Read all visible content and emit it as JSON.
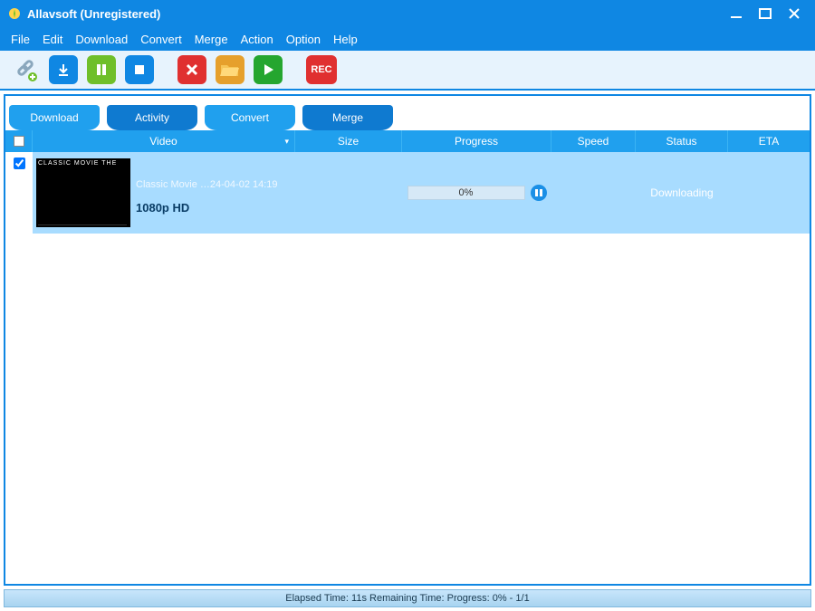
{
  "window": {
    "title": "Allavsoft (Unregistered)"
  },
  "menu": {
    "file": "File",
    "edit": "Edit",
    "download": "Download",
    "convert": "Convert",
    "merge": "Merge",
    "action": "Action",
    "option": "Option",
    "help": "Help"
  },
  "toolbar": {
    "rec_label": "REC"
  },
  "tabs": {
    "download": "Download",
    "activity": "Activity",
    "convert": "Convert",
    "merge": "Merge"
  },
  "columns": {
    "video": "Video",
    "size": "Size",
    "progress": "Progress",
    "speed": "Speed",
    "status": "Status",
    "eta": "ETA"
  },
  "rows": [
    {
      "checked": true,
      "thumb_text": "CLASSIC MOVIE THE",
      "title": "Classic Movie …",
      "datetime": "24-04-02 14:19",
      "quality": "1080p HD",
      "size": "",
      "progress_text": "0%",
      "speed": "",
      "status": "Downloading",
      "eta": ""
    }
  ],
  "statusbar": {
    "text": "Elapsed Time: 11s Remaining Time:  Progress: 0% - 1/1"
  }
}
